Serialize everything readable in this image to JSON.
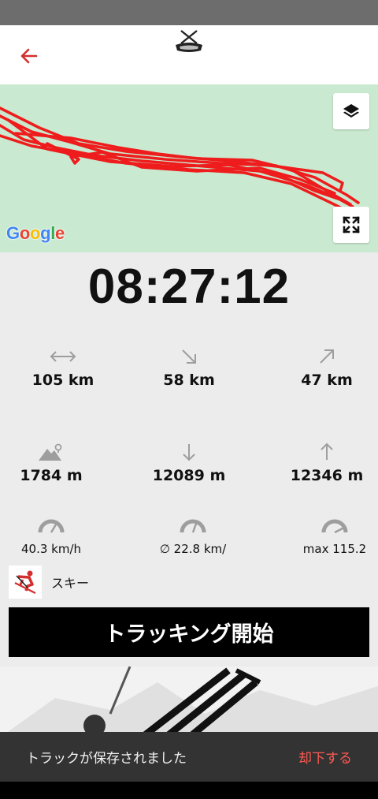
{
  "header": {
    "back_icon": "arrow-left-icon",
    "logo_icon": "ski-logo-icon",
    "accent_color": "#d32f2f"
  },
  "map": {
    "attribution": "Google",
    "layers_icon": "layers-icon",
    "fullscreen_icon": "fullscreen-icon",
    "background_color": "#c9ead0",
    "track_color": "#ee1c1c"
  },
  "timer": "08:27:12",
  "stats": {
    "total_distance": {
      "icon": "horizontal-arrows-icon",
      "value": "105 km"
    },
    "downhill_distance": {
      "icon": "arrow-down-right-icon",
      "value": "58 km"
    },
    "uphill_distance": {
      "icon": "arrow-up-right-icon",
      "value": "47 km"
    },
    "altitude": {
      "icon": "mountain-pin-icon",
      "value": "1784 m"
    },
    "descent": {
      "icon": "arrow-down-icon",
      "value": "12089 m"
    },
    "ascent": {
      "icon": "arrow-up-icon",
      "value": "12346 m"
    },
    "speed": {
      "icon": "gauge-icon",
      "value": "40.3 km/h"
    },
    "avg_speed": {
      "icon": "gauge-icon",
      "value": "∅ 22.8 km/"
    },
    "max_speed": {
      "icon": "gauge-high-icon",
      "value": "max 115.2"
    }
  },
  "sport": {
    "icon": "skier-icon",
    "label": "スキー"
  },
  "start_button": "トラッキング開始",
  "snackbar": {
    "message": "トラックが保存されました",
    "action": "却下する"
  }
}
